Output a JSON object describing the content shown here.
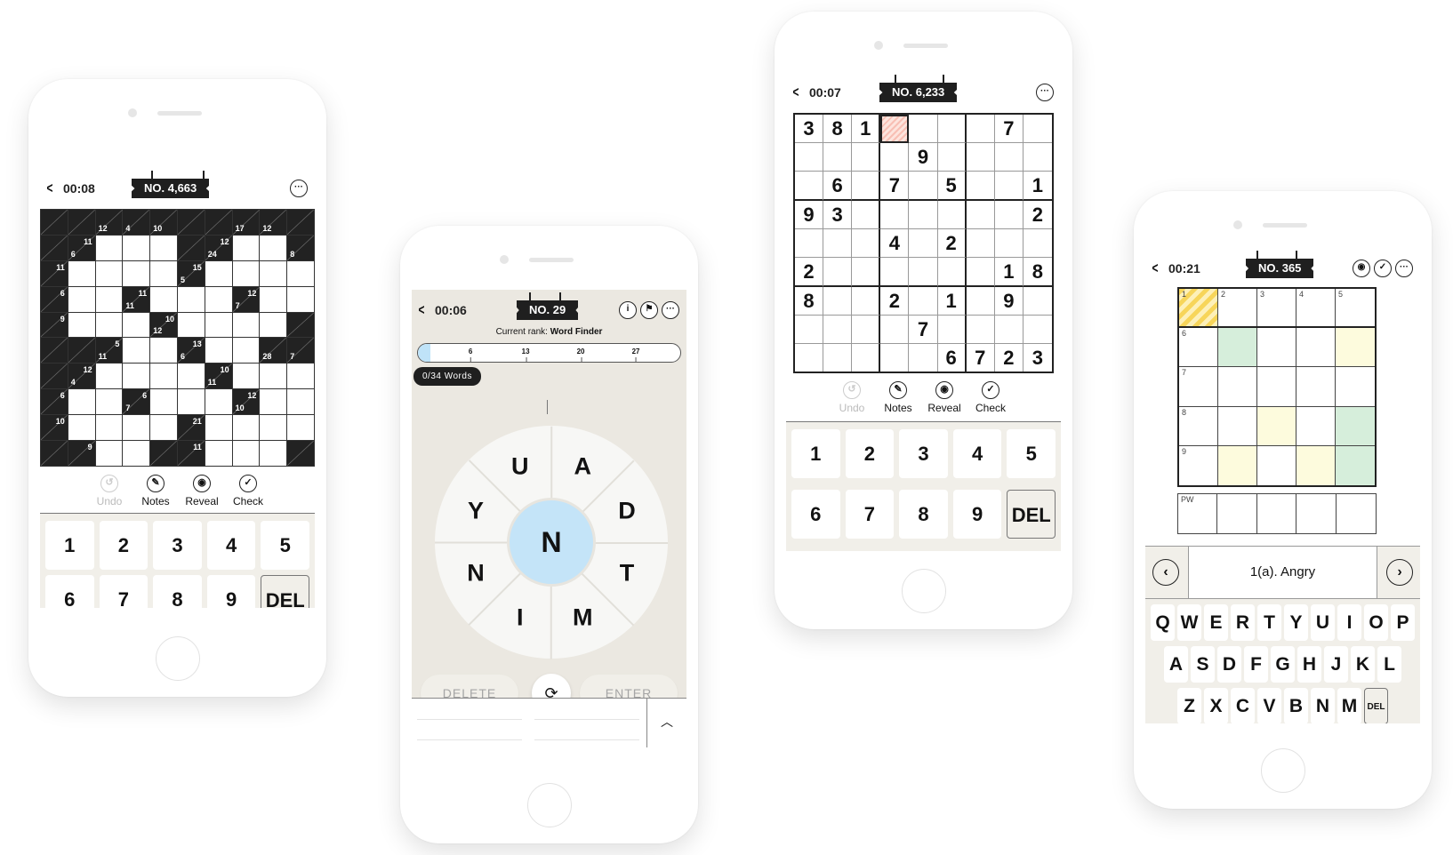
{
  "phones": {
    "kakuro": {
      "timer": "00:08",
      "puzzle_no": "NO. 4,663",
      "grid": [
        [
          [
            "b"
          ],
          [
            "b"
          ],
          [
            "b",
            12,
            null
          ],
          [
            "b",
            4,
            null
          ],
          [
            "b",
            10,
            null
          ],
          [
            "b"
          ],
          [
            "b"
          ],
          [
            "b",
            17,
            null
          ],
          [
            "b",
            12,
            null
          ],
          [
            "b"
          ]
        ],
        [
          [
            "b"
          ],
          [
            "b",
            6,
            11
          ],
          [
            "w"
          ],
          [
            "w"
          ],
          [
            "w"
          ],
          [
            "b"
          ],
          [
            "b",
            24,
            12
          ],
          [
            "w"
          ],
          [
            "w"
          ],
          [
            "b",
            8,
            null
          ]
        ],
        [
          [
            "b",
            null,
            11
          ],
          [
            "w"
          ],
          [
            "w"
          ],
          [
            "w"
          ],
          [
            "w"
          ],
          [
            "b",
            5,
            15
          ],
          [
            "w"
          ],
          [
            "w"
          ],
          [
            "w"
          ],
          [
            "w"
          ]
        ],
        [
          [
            "b",
            null,
            6
          ],
          [
            "w"
          ],
          [
            "w"
          ],
          [
            "b",
            11,
            11
          ],
          [
            "w"
          ],
          [
            "w"
          ],
          [
            "w"
          ],
          [
            "b",
            7,
            12
          ],
          [
            "w"
          ],
          [
            "w"
          ]
        ],
        [
          [
            "b",
            null,
            9
          ],
          [
            "w"
          ],
          [
            "w"
          ],
          [
            "w"
          ],
          [
            "b",
            12,
            10
          ],
          [
            "w"
          ],
          [
            "w"
          ],
          [
            "w"
          ],
          [
            "w"
          ],
          [
            "b"
          ]
        ],
        [
          [
            "b"
          ],
          [
            "b"
          ],
          [
            "b",
            11,
            5
          ],
          [
            "w"
          ],
          [
            "w"
          ],
          [
            "b",
            6,
            13
          ],
          [
            "w"
          ],
          [
            "w"
          ],
          [
            "b",
            28,
            null
          ],
          [
            "b",
            7,
            null
          ]
        ],
        [
          [
            "b"
          ],
          [
            "b",
            4,
            12
          ],
          [
            "w"
          ],
          [
            "w"
          ],
          [
            "w"
          ],
          [
            "w"
          ],
          [
            "b",
            11,
            10
          ],
          [
            "w"
          ],
          [
            "w"
          ],
          [
            "w"
          ]
        ],
        [
          [
            "b",
            null,
            6
          ],
          [
            "w"
          ],
          [
            "w"
          ],
          [
            "b",
            7,
            6
          ],
          [
            "w"
          ],
          [
            "w"
          ],
          [
            "w"
          ],
          [
            "b",
            10,
            12
          ],
          [
            "w"
          ],
          [
            "w"
          ]
        ],
        [
          [
            "b",
            null,
            10
          ],
          [
            "w"
          ],
          [
            "w"
          ],
          [
            "w"
          ],
          [
            "w"
          ],
          [
            "b",
            null,
            21
          ],
          [
            "w"
          ],
          [
            "w"
          ],
          [
            "w"
          ],
          [
            "w"
          ]
        ],
        [
          [
            "b"
          ],
          [
            "b",
            null,
            9
          ],
          [
            "w"
          ],
          [
            "w"
          ],
          [
            "b"
          ],
          [
            "b",
            null,
            11
          ],
          [
            "w"
          ],
          [
            "w"
          ],
          [
            "w"
          ],
          [
            "b"
          ]
        ]
      ],
      "tools": [
        {
          "label": "Undo",
          "icon": "undo-icon",
          "glyph": "↺",
          "disabled": true
        },
        {
          "label": "Notes",
          "icon": "pencil-icon",
          "glyph": "✎",
          "disabled": false
        },
        {
          "label": "Reveal",
          "icon": "eye-icon",
          "glyph": "◉",
          "disabled": false
        },
        {
          "label": "Check",
          "icon": "check-icon",
          "glyph": "✓",
          "disabled": false
        }
      ],
      "keys": [
        "1",
        "2",
        "3",
        "4",
        "5",
        "6",
        "7",
        "8",
        "9",
        "DEL"
      ]
    },
    "wordfinder": {
      "timer": "00:06",
      "puzzle_no": "NO. 29",
      "rank_label": "Current rank: ",
      "rank_value": "Word Finder",
      "progress_ticks": [
        "6",
        "13",
        "20",
        "27"
      ],
      "progress_max": 34,
      "words_found": "0/34 Words",
      "center_letter": "N",
      "outer_letters": [
        "A",
        "D",
        "T",
        "M",
        "I",
        "N",
        "Y",
        "U"
      ],
      "delete_label": "DELETE",
      "enter_label": "ENTER"
    },
    "sudoku": {
      "timer": "00:07",
      "puzzle_no": "NO. 6,233",
      "selected_cell": [
        0,
        3
      ],
      "grid": [
        [
          "3",
          "8",
          "1",
          "",
          "",
          "",
          "",
          "7",
          ""
        ],
        [
          "",
          "",
          "",
          "",
          "9",
          "",
          "",
          "",
          ""
        ],
        [
          "",
          "6",
          "",
          "7",
          "",
          "5",
          "",
          "",
          "1"
        ],
        [
          "9",
          "3",
          "",
          "",
          "",
          "",
          "",
          "",
          "2"
        ],
        [
          "",
          "",
          "",
          "4",
          "",
          "2",
          "",
          "",
          ""
        ],
        [
          "2",
          "",
          "",
          "",
          "",
          "",
          "",
          "1",
          "8"
        ],
        [
          "8",
          "",
          "",
          "2",
          "",
          "1",
          "",
          "9",
          ""
        ],
        [
          "",
          "",
          "",
          "",
          "7",
          "",
          "",
          "",
          ""
        ],
        [
          "",
          "",
          "",
          "",
          "",
          "6",
          "7",
          "2",
          "3"
        ]
      ],
      "tools": [
        {
          "label": "Undo",
          "icon": "undo-icon",
          "glyph": "↺",
          "disabled": true
        },
        {
          "label": "Notes",
          "icon": "pencil-icon",
          "glyph": "✎",
          "disabled": false
        },
        {
          "label": "Reveal",
          "icon": "eye-icon",
          "glyph": "◉",
          "disabled": false
        },
        {
          "label": "Check",
          "icon": "check-icon",
          "glyph": "✓",
          "disabled": false
        }
      ],
      "keys": [
        "1",
        "2",
        "3",
        "4",
        "5",
        "6",
        "7",
        "8",
        "9",
        "DEL"
      ]
    },
    "crossword": {
      "timer": "00:21",
      "puzzle_no": "NO. 365",
      "row_numbers": [
        "1",
        "6",
        "7",
        "8",
        "9"
      ],
      "col_numbers": [
        "1",
        "2",
        "3",
        "4",
        "5"
      ],
      "cell_colors": [
        [
          "sel",
          "",
          "",
          "",
          ""
        ],
        [
          "",
          "g",
          "",
          "",
          "y"
        ],
        [
          "",
          "",
          "",
          "",
          ""
        ],
        [
          "",
          "",
          "y",
          "",
          "g"
        ],
        [
          "",
          "y",
          "",
          "y",
          "g"
        ]
      ],
      "password_label": "PW",
      "clue": "1(a). Angry",
      "keyboard": [
        [
          "Q",
          "W",
          "E",
          "R",
          "T",
          "Y",
          "U",
          "I",
          "O",
          "P"
        ],
        [
          "A",
          "S",
          "D",
          "F",
          "G",
          "H",
          "J",
          "K",
          "L"
        ],
        [
          "Z",
          "X",
          "C",
          "V",
          "B",
          "N",
          "M",
          "DEL"
        ]
      ]
    }
  }
}
